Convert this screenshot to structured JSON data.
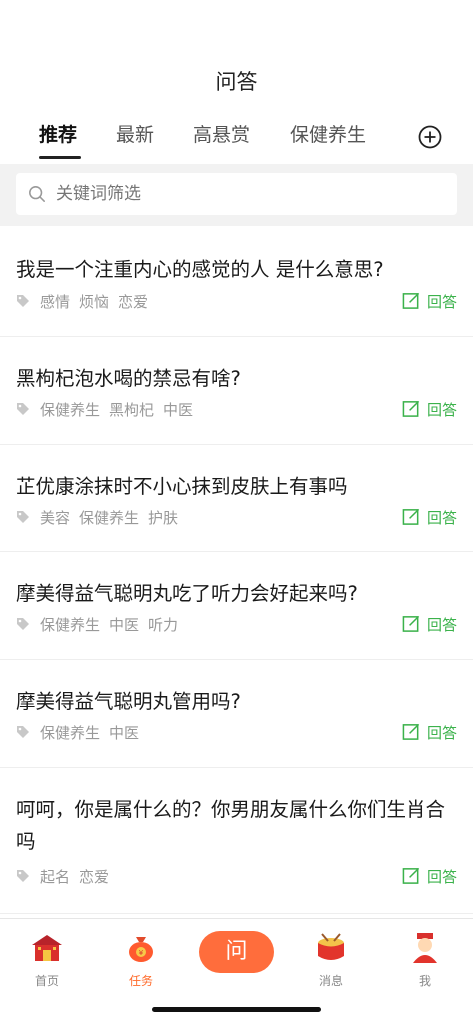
{
  "header": {
    "title": "问答",
    "tabs": [
      {
        "label": "推荐"
      },
      {
        "label": "最新"
      },
      {
        "label": "高悬赏"
      },
      {
        "label": "保健养生"
      }
    ]
  },
  "search": {
    "placeholder": "关键词筛选"
  },
  "questions": [
    {
      "title": "我是一个注重内心的感觉的人 是什么意思?",
      "tags": [
        "感情",
        "烦恼",
        "恋爱"
      ],
      "action": "回答"
    },
    {
      "title": "黑枸杞泡水喝的禁忌有啥?",
      "tags": [
        "保健养生",
        "黑枸杞",
        "中医"
      ],
      "action": "回答"
    },
    {
      "title": "芷优康涂抹时不小心抹到皮肤上有事吗",
      "tags": [
        "美容",
        "保健养生",
        "护肤"
      ],
      "action": "回答"
    },
    {
      "title": "摩美得益气聪明丸吃了听力会好起来吗?",
      "tags": [
        "保健养生",
        "中医",
        "听力"
      ],
      "action": "回答"
    },
    {
      "title": "摩美得益气聪明丸管用吗?",
      "tags": [
        "保健养生",
        "中医"
      ],
      "action": "回答"
    },
    {
      "title": "呵呵，你是属什么的？你男朋友属什么你们生肖合吗",
      "tags": [
        "起名",
        "恋爱"
      ],
      "action": "回答"
    }
  ],
  "bottom_nav": {
    "home": "首页",
    "task": "任务",
    "ask": "问",
    "message": "消息",
    "me": "我"
  },
  "colors": {
    "accent_green": "#3bb24b",
    "accent_orange": "#ff6d3c",
    "tag_gray": "#999999"
  }
}
